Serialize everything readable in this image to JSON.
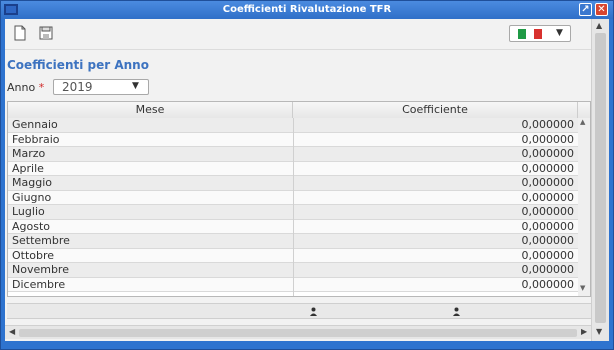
{
  "window": {
    "title": "Coefficienti Rivalutazione TFR"
  },
  "colors": {
    "titlebar": "#2f6fc8",
    "accent": "#3d73c0",
    "required": "#d02828"
  },
  "toolbar": {
    "new_icon": "new-document-icon",
    "save_icon": "save-icon",
    "language_flag": "italian-flag"
  },
  "section": {
    "title": "Coefficienti per Anno"
  },
  "year": {
    "label": "Anno",
    "required_mark": "*",
    "value": "2019"
  },
  "table": {
    "headers": {
      "month": "Mese",
      "coefficient": "Coefficiente"
    },
    "rows": [
      {
        "month": "Gennaio",
        "coefficient": "0,000000"
      },
      {
        "month": "Febbraio",
        "coefficient": "0,000000"
      },
      {
        "month": "Marzo",
        "coefficient": "0,000000"
      },
      {
        "month": "Aprile",
        "coefficient": "0,000000"
      },
      {
        "month": "Maggio",
        "coefficient": "0,000000"
      },
      {
        "month": "Giugno",
        "coefficient": "0,000000"
      },
      {
        "month": "Luglio",
        "coefficient": "0,000000"
      },
      {
        "month": "Agosto",
        "coefficient": "0,000000"
      },
      {
        "month": "Settembre",
        "coefficient": "0,000000"
      },
      {
        "month": "Ottobre",
        "coefficient": "0,000000"
      },
      {
        "month": "Novembre",
        "coefficient": "0,000000"
      },
      {
        "month": "Dicembre",
        "coefficient": "0,000000"
      }
    ]
  }
}
